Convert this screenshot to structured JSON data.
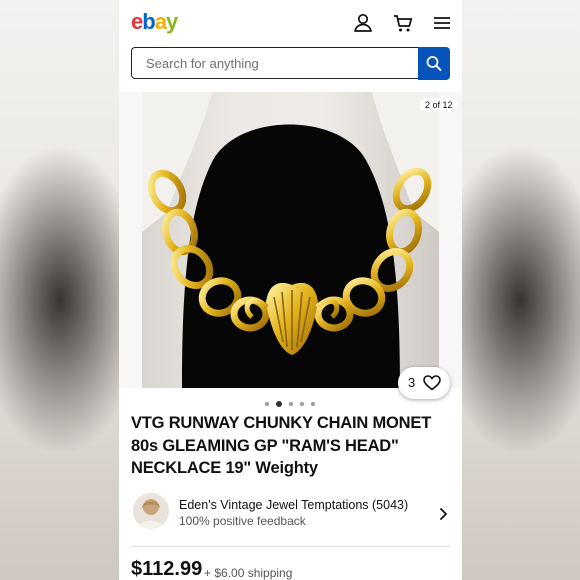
{
  "header": {
    "logo": {
      "letters": [
        "e",
        "b",
        "a",
        "y"
      ],
      "colors": [
        "#e53238",
        "#0064d2",
        "#f5af02",
        "#86b817"
      ]
    },
    "icons": [
      "account-icon",
      "cart-icon",
      "menu-icon"
    ]
  },
  "search": {
    "placeholder": "Search for anything"
  },
  "gallery": {
    "counter": "2 of 12",
    "likes": "3",
    "dot_count": 5,
    "active_dot": 1
  },
  "listing": {
    "title": "VTG RUNWAY CHUNKY CHAIN MONET 80s GLEAMING GP \"RAM'S HEAD\" NECKLACE 19\" Weighty"
  },
  "seller": {
    "name": "Eden's Vintage Jewel Temptations (5043)",
    "feedback": "100% positive feedback"
  },
  "price": {
    "amount": "$112.99",
    "shipping": "+ $6.00 shipping"
  }
}
